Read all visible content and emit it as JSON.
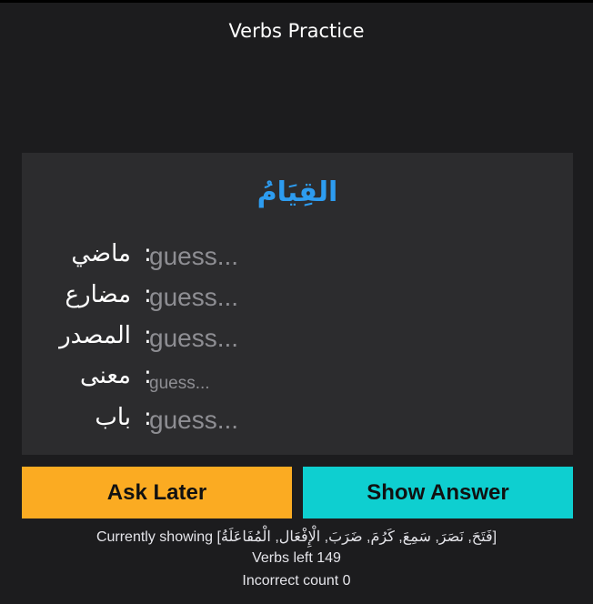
{
  "header": {
    "title": "Verbs Practice"
  },
  "card": {
    "word": "القِيَامُ",
    "rows": [
      {
        "label": "ماضي",
        "placeholder": "guess..."
      },
      {
        "label": "مضارع",
        "placeholder": "guess..."
      },
      {
        "label": "المصدر",
        "placeholder": "guess..."
      },
      {
        "label": "معنى",
        "placeholder": "guess..."
      },
      {
        "label": "باب",
        "placeholder": "guess..."
      }
    ],
    "separator": ":"
  },
  "buttons": {
    "ask_later": "Ask Later",
    "show_answer": "Show Answer"
  },
  "colors": {
    "accent_word": "#2d9cf0",
    "ask_later_bg": "#fbab22",
    "show_answer_bg": "#0ecfd0"
  },
  "footer": {
    "showing_prefix": "Currently showing",
    "showing_list": "[فَتَحَ, نَصَرَ, سَمِعَ, كَرُمَ, ضَرَبَ, الْإِفْعَال, الْمُفَاعَلَةُ]",
    "verbs_left": "Verbs left 149",
    "incorrect_count": "Incorrect count 0"
  }
}
